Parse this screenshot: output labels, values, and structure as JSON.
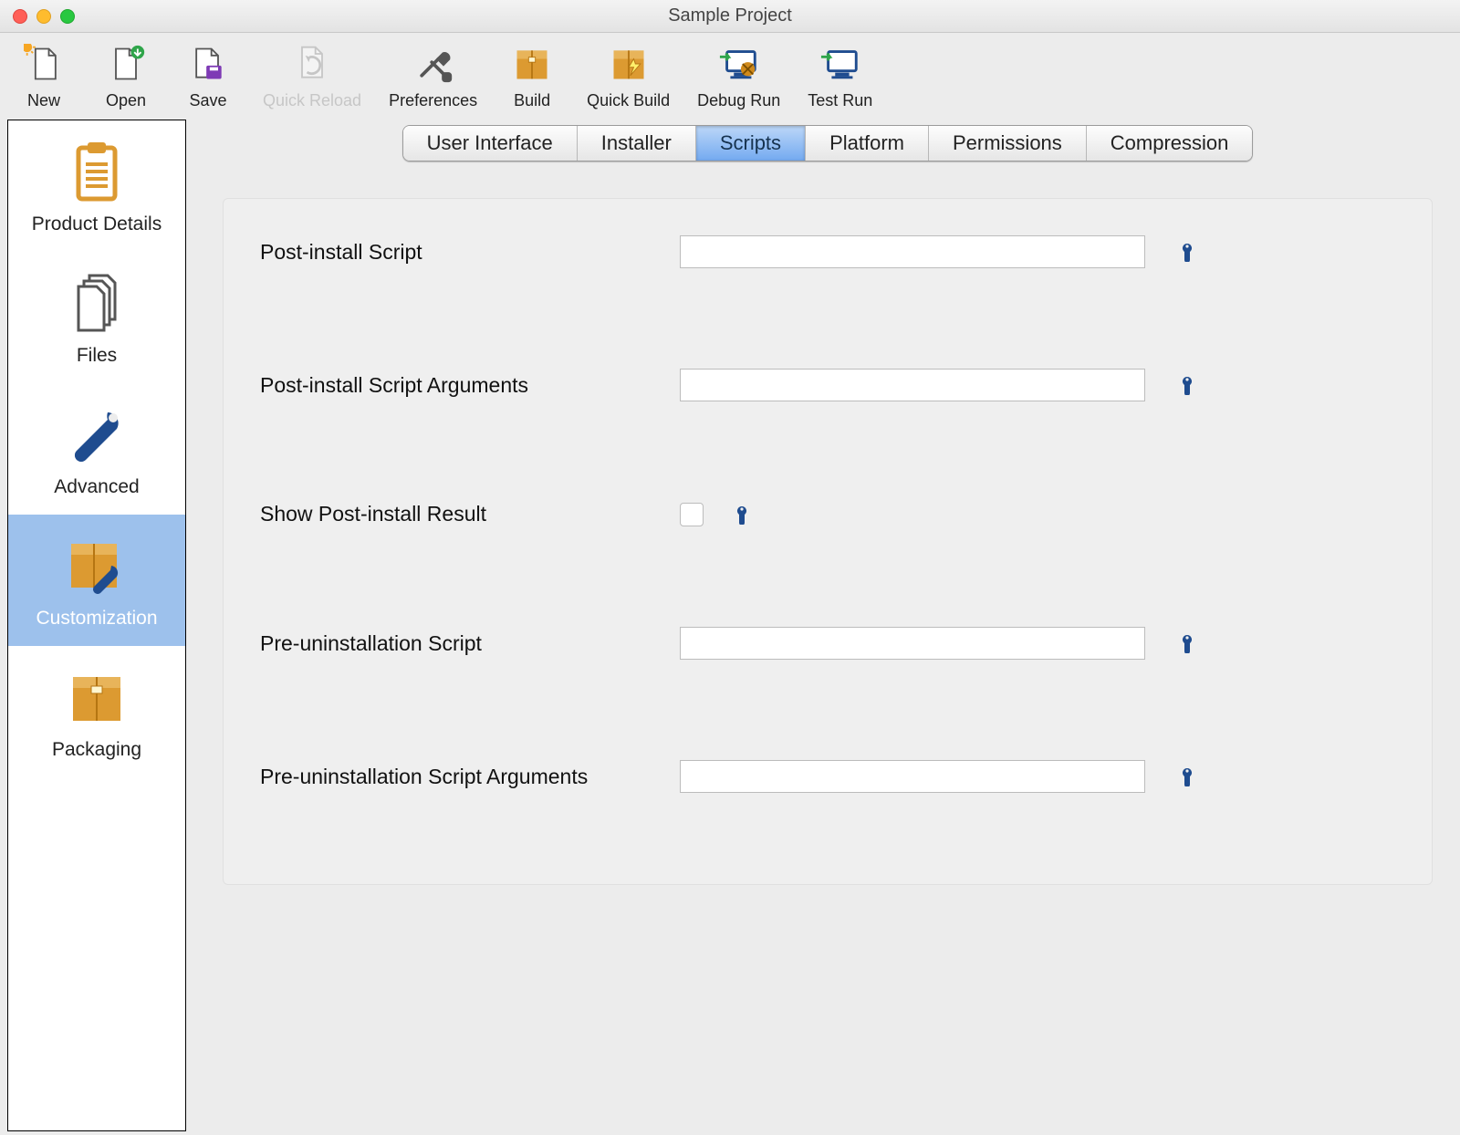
{
  "window": {
    "title": "Sample Project"
  },
  "toolbar": {
    "items": [
      {
        "id": "new",
        "label": "New",
        "icon": "new-file-icon",
        "enabled": true
      },
      {
        "id": "open",
        "label": "Open",
        "icon": "open-file-icon",
        "enabled": true
      },
      {
        "id": "save",
        "label": "Save",
        "icon": "save-icon",
        "enabled": true
      },
      {
        "id": "quick_reload",
        "label": "Quick Reload",
        "icon": "reload-icon",
        "enabled": false
      },
      {
        "id": "preferences",
        "label": "Preferences",
        "icon": "preferences-icon",
        "enabled": true
      },
      {
        "id": "build",
        "label": "Build",
        "icon": "build-icon",
        "enabled": true
      },
      {
        "id": "quick_build",
        "label": "Quick Build",
        "icon": "quick-build-icon",
        "enabled": true
      },
      {
        "id": "debug_run",
        "label": "Debug Run",
        "icon": "debug-run-icon",
        "enabled": true
      },
      {
        "id": "test_run",
        "label": "Test Run",
        "icon": "test-run-icon",
        "enabled": true
      }
    ]
  },
  "sidebar": {
    "items": [
      {
        "id": "product_details",
        "label": "Product Details",
        "icon": "clipboard-icon",
        "selected": false
      },
      {
        "id": "files",
        "label": "Files",
        "icon": "files-icon",
        "selected": false
      },
      {
        "id": "advanced",
        "label": "Advanced",
        "icon": "wrench-icon",
        "selected": false
      },
      {
        "id": "customization",
        "label": "Customization",
        "icon": "box-wrench-icon",
        "selected": true
      },
      {
        "id": "packaging",
        "label": "Packaging",
        "icon": "box-icon",
        "selected": false
      }
    ]
  },
  "tabs": {
    "items": [
      {
        "id": "ui",
        "label": "User Interface",
        "active": false
      },
      {
        "id": "installer",
        "label": "Installer",
        "active": false
      },
      {
        "id": "scripts",
        "label": "Scripts",
        "active": true
      },
      {
        "id": "platform",
        "label": "Platform",
        "active": false
      },
      {
        "id": "permissions",
        "label": "Permissions",
        "active": false
      },
      {
        "id": "compression",
        "label": "Compression",
        "active": false
      }
    ]
  },
  "form": {
    "rows": [
      {
        "id": "post_install_script",
        "label": "Post-install Script",
        "type": "text",
        "value": ""
      },
      {
        "id": "post_install_script_args",
        "label": "Post-install Script Arguments",
        "type": "text",
        "value": ""
      },
      {
        "id": "show_post_install_result",
        "label": "Show Post-install Result",
        "type": "checkbox",
        "checked": false
      },
      {
        "id": "pre_uninstall_script",
        "label": "Pre-uninstallation Script",
        "type": "text",
        "value": ""
      },
      {
        "id": "pre_uninstall_script_args",
        "label": "Pre-uninstallation Script Arguments",
        "type": "text",
        "value": ""
      }
    ]
  },
  "colors": {
    "accent_blue": "#1f4c8f",
    "sidebar_selected": "#9dc1ec",
    "tab_active_grad_top": "#bcd7f8",
    "tab_active_grad_bottom": "#74aaf0",
    "box_orange": "#dc9a31"
  }
}
